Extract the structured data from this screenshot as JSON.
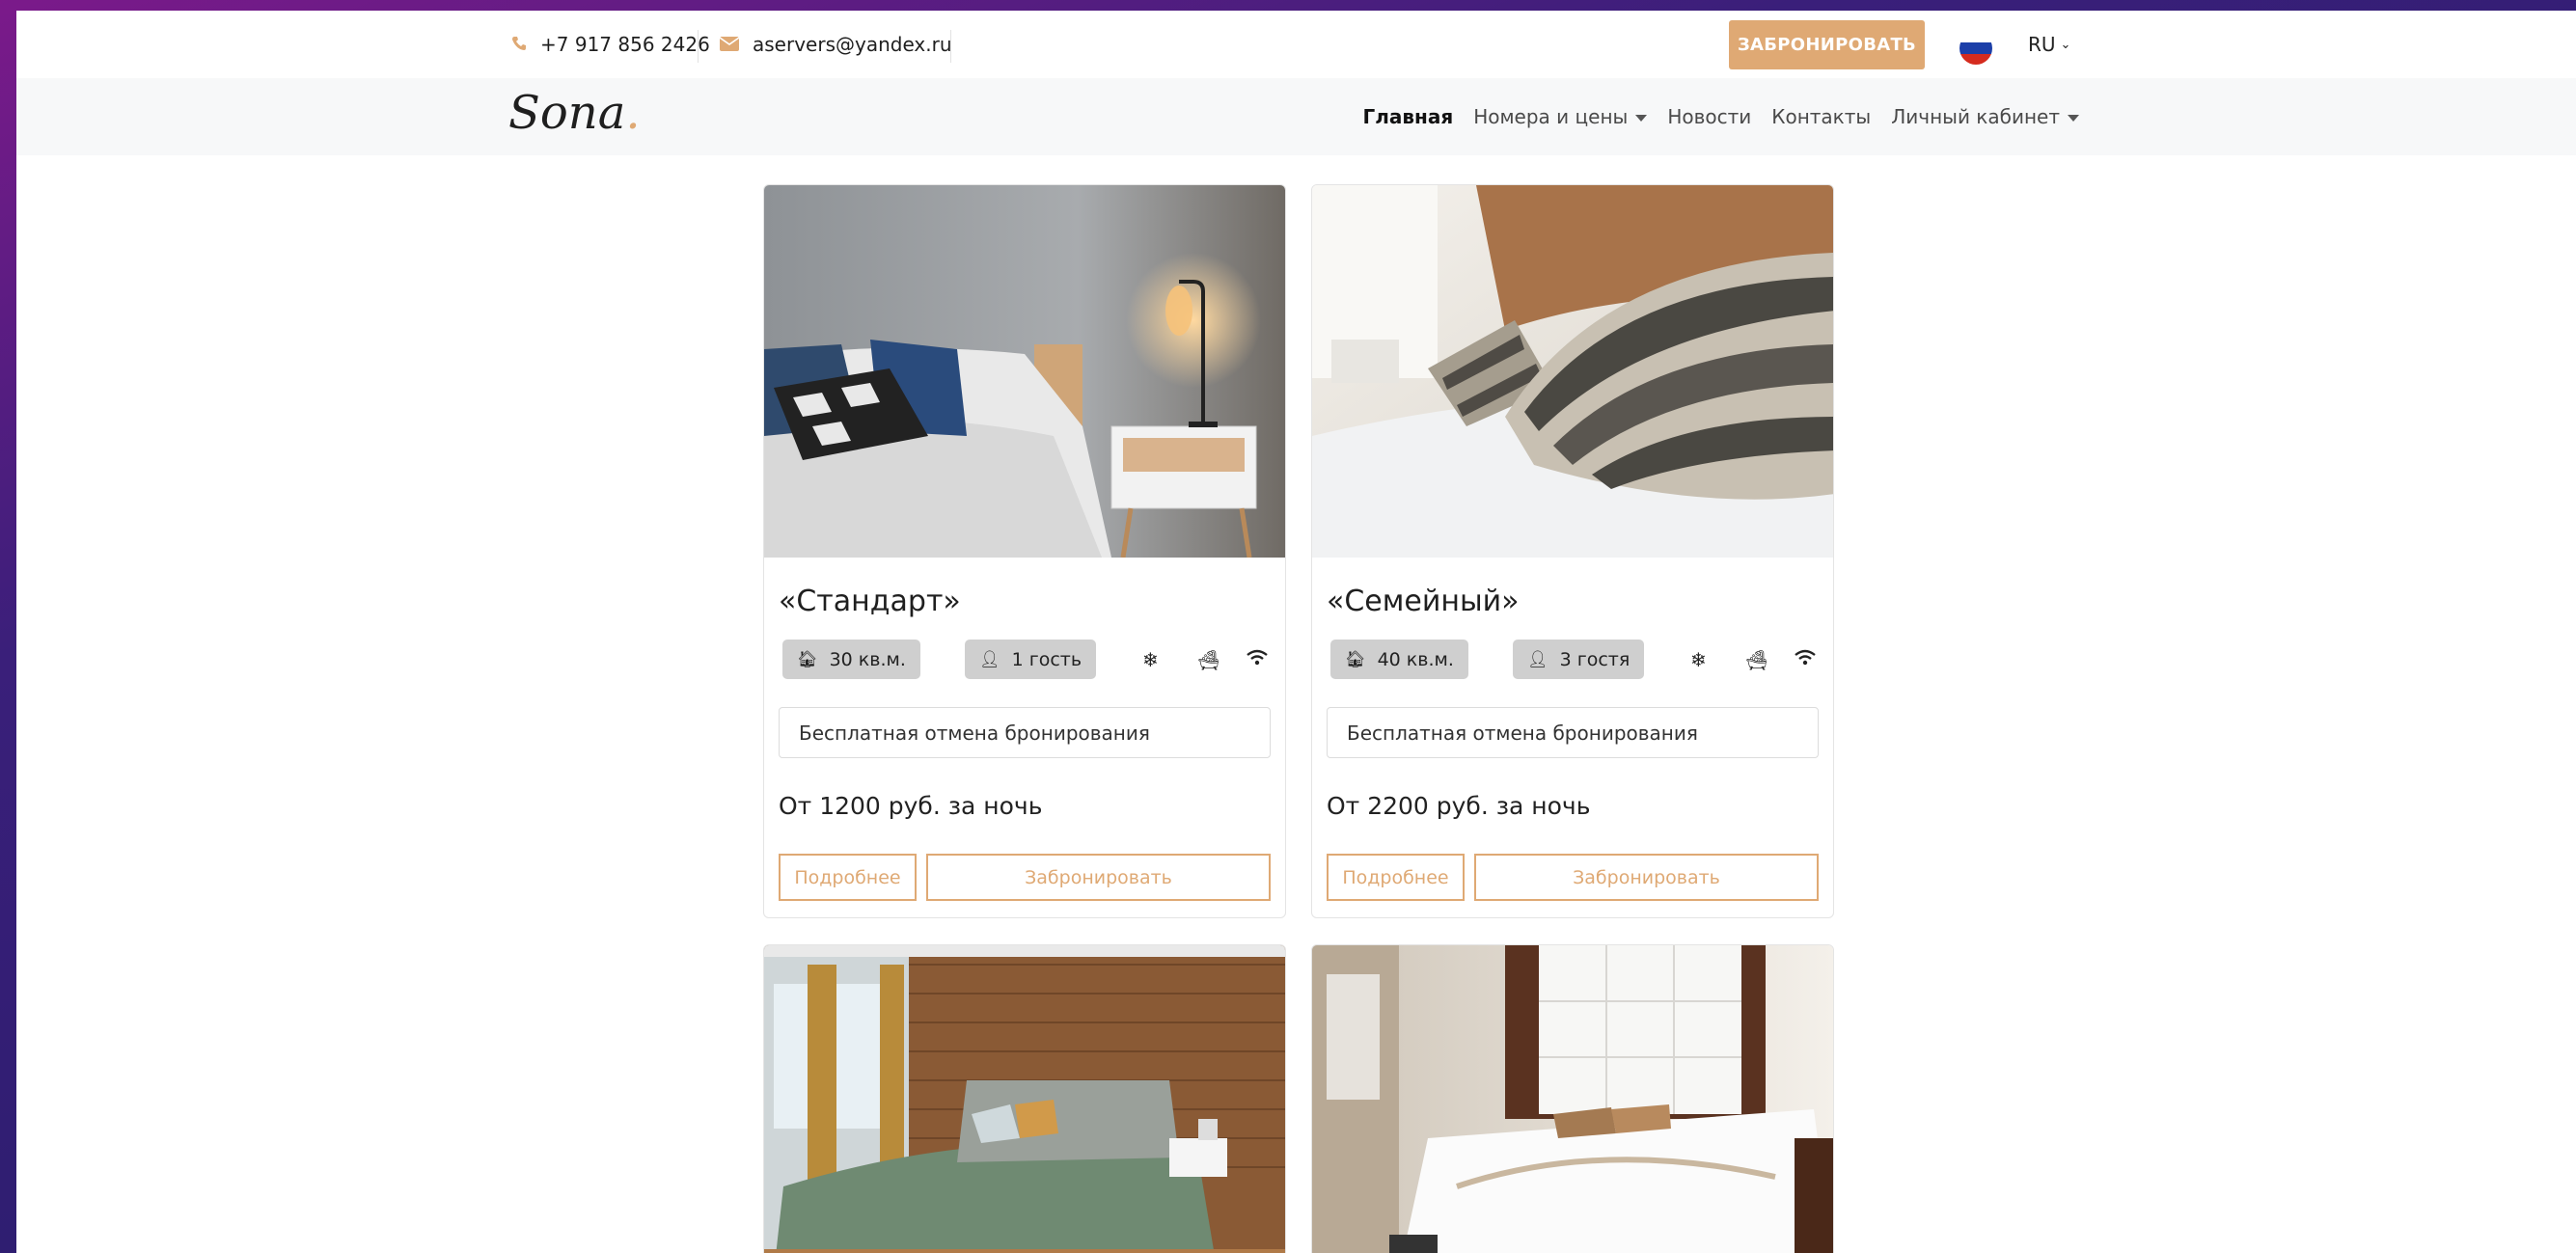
{
  "topbar": {
    "phone": "+7 917 856 2426",
    "email": "aservers@yandex.ru",
    "book_button": "ЗАБРОНИРОВАТЬ",
    "language": "RU"
  },
  "navbar": {
    "logo": "Sona",
    "logo_dot": ".",
    "items": [
      {
        "label": "Главная"
      },
      {
        "label": "Номера и цены"
      },
      {
        "label": "Новости"
      },
      {
        "label": "Контакты"
      },
      {
        "label": "Личный кабинет"
      }
    ]
  },
  "rooms": [
    {
      "title": "«Стандарт»",
      "area": "30 кв.м.",
      "guests": "1 гость",
      "cancel": "Бесплатная отмена бронирования",
      "price": "От 1200 руб. за ночь",
      "more": "Подробнее",
      "book": "Забронировать"
    },
    {
      "title": "«Семейный»",
      "area": "40 кв.м.",
      "guests": "3 гостя",
      "cancel": "Бесплатная отмена бронирования",
      "price": "От 2200 руб. за ночь",
      "more": "Подробнее",
      "book": "Забронировать"
    },
    {},
    {}
  ],
  "colors": {
    "accent": "#dfa974",
    "navbar_bg": "#f7f8f9"
  },
  "icons": {
    "phone": "phone-icon",
    "email": "envelope-icon",
    "area": "home-icon",
    "guests": "user-icon",
    "ac": "snowflake-icon",
    "bath": "bathtub-icon",
    "wifi": "wifi-icon"
  }
}
